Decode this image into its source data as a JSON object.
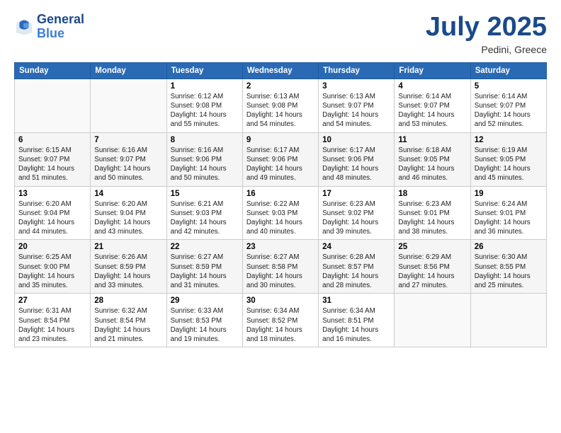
{
  "header": {
    "logo_line1": "General",
    "logo_line2": "Blue",
    "month": "July 2025",
    "location": "Pedini, Greece"
  },
  "weekdays": [
    "Sunday",
    "Monday",
    "Tuesday",
    "Wednesday",
    "Thursday",
    "Friday",
    "Saturday"
  ],
  "weeks": [
    [
      {
        "day": "",
        "detail": ""
      },
      {
        "day": "",
        "detail": ""
      },
      {
        "day": "1",
        "detail": "Sunrise: 6:12 AM\nSunset: 9:08 PM\nDaylight: 14 hours and 55 minutes."
      },
      {
        "day": "2",
        "detail": "Sunrise: 6:13 AM\nSunset: 9:08 PM\nDaylight: 14 hours and 54 minutes."
      },
      {
        "day": "3",
        "detail": "Sunrise: 6:13 AM\nSunset: 9:07 PM\nDaylight: 14 hours and 54 minutes."
      },
      {
        "day": "4",
        "detail": "Sunrise: 6:14 AM\nSunset: 9:07 PM\nDaylight: 14 hours and 53 minutes."
      },
      {
        "day": "5",
        "detail": "Sunrise: 6:14 AM\nSunset: 9:07 PM\nDaylight: 14 hours and 52 minutes."
      }
    ],
    [
      {
        "day": "6",
        "detail": "Sunrise: 6:15 AM\nSunset: 9:07 PM\nDaylight: 14 hours and 51 minutes."
      },
      {
        "day": "7",
        "detail": "Sunrise: 6:16 AM\nSunset: 9:07 PM\nDaylight: 14 hours and 50 minutes."
      },
      {
        "day": "8",
        "detail": "Sunrise: 6:16 AM\nSunset: 9:06 PM\nDaylight: 14 hours and 50 minutes."
      },
      {
        "day": "9",
        "detail": "Sunrise: 6:17 AM\nSunset: 9:06 PM\nDaylight: 14 hours and 49 minutes."
      },
      {
        "day": "10",
        "detail": "Sunrise: 6:17 AM\nSunset: 9:06 PM\nDaylight: 14 hours and 48 minutes."
      },
      {
        "day": "11",
        "detail": "Sunrise: 6:18 AM\nSunset: 9:05 PM\nDaylight: 14 hours and 46 minutes."
      },
      {
        "day": "12",
        "detail": "Sunrise: 6:19 AM\nSunset: 9:05 PM\nDaylight: 14 hours and 45 minutes."
      }
    ],
    [
      {
        "day": "13",
        "detail": "Sunrise: 6:20 AM\nSunset: 9:04 PM\nDaylight: 14 hours and 44 minutes."
      },
      {
        "day": "14",
        "detail": "Sunrise: 6:20 AM\nSunset: 9:04 PM\nDaylight: 14 hours and 43 minutes."
      },
      {
        "day": "15",
        "detail": "Sunrise: 6:21 AM\nSunset: 9:03 PM\nDaylight: 14 hours and 42 minutes."
      },
      {
        "day": "16",
        "detail": "Sunrise: 6:22 AM\nSunset: 9:03 PM\nDaylight: 14 hours and 40 minutes."
      },
      {
        "day": "17",
        "detail": "Sunrise: 6:23 AM\nSunset: 9:02 PM\nDaylight: 14 hours and 39 minutes."
      },
      {
        "day": "18",
        "detail": "Sunrise: 6:23 AM\nSunset: 9:01 PM\nDaylight: 14 hours and 38 minutes."
      },
      {
        "day": "19",
        "detail": "Sunrise: 6:24 AM\nSunset: 9:01 PM\nDaylight: 14 hours and 36 minutes."
      }
    ],
    [
      {
        "day": "20",
        "detail": "Sunrise: 6:25 AM\nSunset: 9:00 PM\nDaylight: 14 hours and 35 minutes."
      },
      {
        "day": "21",
        "detail": "Sunrise: 6:26 AM\nSunset: 8:59 PM\nDaylight: 14 hours and 33 minutes."
      },
      {
        "day": "22",
        "detail": "Sunrise: 6:27 AM\nSunset: 8:59 PM\nDaylight: 14 hours and 31 minutes."
      },
      {
        "day": "23",
        "detail": "Sunrise: 6:27 AM\nSunset: 8:58 PM\nDaylight: 14 hours and 30 minutes."
      },
      {
        "day": "24",
        "detail": "Sunrise: 6:28 AM\nSunset: 8:57 PM\nDaylight: 14 hours and 28 minutes."
      },
      {
        "day": "25",
        "detail": "Sunrise: 6:29 AM\nSunset: 8:56 PM\nDaylight: 14 hours and 27 minutes."
      },
      {
        "day": "26",
        "detail": "Sunrise: 6:30 AM\nSunset: 8:55 PM\nDaylight: 14 hours and 25 minutes."
      }
    ],
    [
      {
        "day": "27",
        "detail": "Sunrise: 6:31 AM\nSunset: 8:54 PM\nDaylight: 14 hours and 23 minutes."
      },
      {
        "day": "28",
        "detail": "Sunrise: 6:32 AM\nSunset: 8:54 PM\nDaylight: 14 hours and 21 minutes."
      },
      {
        "day": "29",
        "detail": "Sunrise: 6:33 AM\nSunset: 8:53 PM\nDaylight: 14 hours and 19 minutes."
      },
      {
        "day": "30",
        "detail": "Sunrise: 6:34 AM\nSunset: 8:52 PM\nDaylight: 14 hours and 18 minutes."
      },
      {
        "day": "31",
        "detail": "Sunrise: 6:34 AM\nSunset: 8:51 PM\nDaylight: 14 hours and 16 minutes."
      },
      {
        "day": "",
        "detail": ""
      },
      {
        "day": "",
        "detail": ""
      }
    ]
  ]
}
